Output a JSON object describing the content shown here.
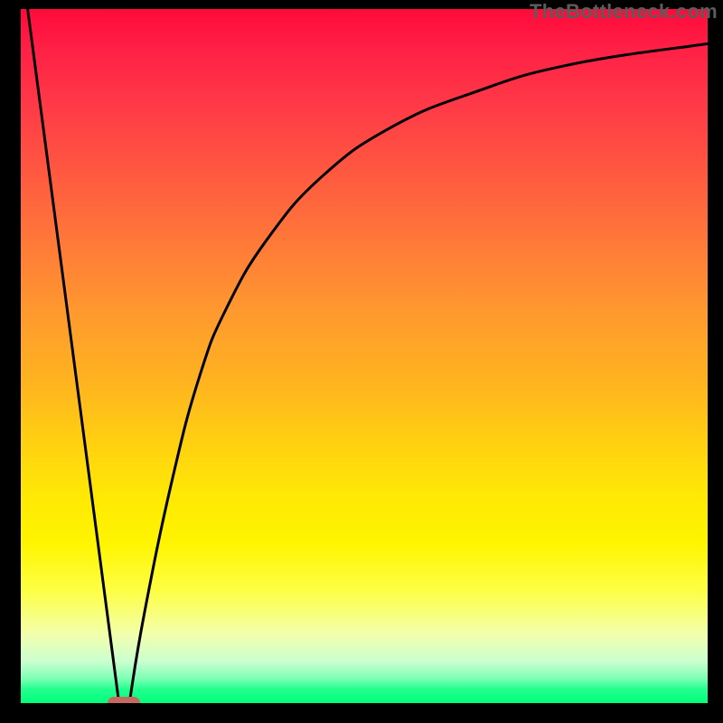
{
  "watermark": "TheBottleneck.com",
  "chart_data": {
    "type": "line",
    "title": "",
    "xlabel": "",
    "ylabel": "",
    "xlim": [
      0,
      100
    ],
    "ylim": [
      0,
      100
    ],
    "series": [
      {
        "name": "bottleneck-curve",
        "x": [
          1,
          14.3,
          15.8,
          18,
          22,
          26,
          30,
          36,
          44,
          54,
          66,
          80,
          100
        ],
        "y": [
          100,
          0,
          0,
          13,
          32,
          47,
          57,
          67,
          76,
          83,
          88,
          92,
          95
        ]
      }
    ],
    "marker": {
      "name": "minimum-lozenge",
      "x": 15.0,
      "y": 0,
      "color": "#c46a63"
    },
    "grid": false
  }
}
